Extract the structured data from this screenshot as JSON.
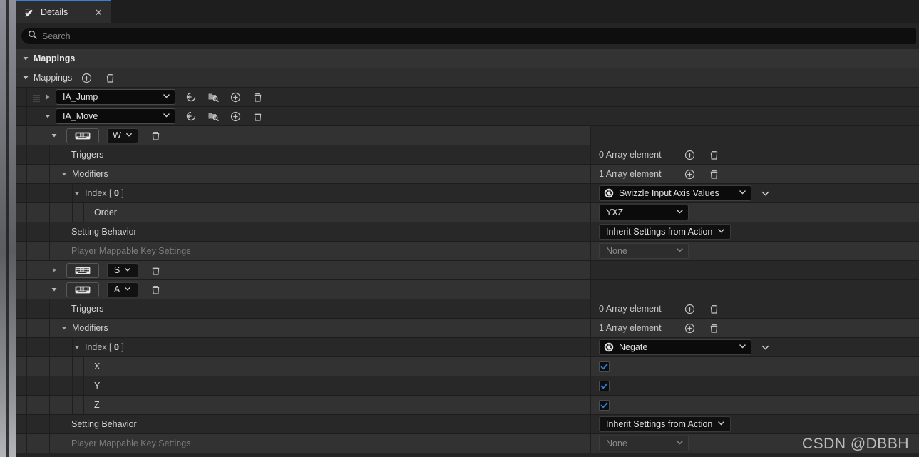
{
  "tab": {
    "title": "Details",
    "icon": "details-edit-icon",
    "close": "✕"
  },
  "search": {
    "placeholder": "Search",
    "icon": "search-icon"
  },
  "accent_color": "#3a7fd5",
  "checkbox_color": "#2a7fe0",
  "watermark": "CSDN @DBBH",
  "labels": {
    "category_mappings": "Mappings",
    "array_mappings": "Mappings",
    "triggers": "Triggers",
    "modifiers": "Modifiers",
    "index0": "Index [ 0 ]",
    "index_prefix": "Index [ ",
    "index_value": "0",
    "index_suffix": " ]",
    "order": "Order",
    "setting_behavior": "Setting Behavior",
    "player_mappable": "Player Mappable Key Settings",
    "axis_x": "X",
    "axis_y": "Y",
    "axis_z": "Z"
  },
  "values": {
    "action_jump": "IA_Jump",
    "action_move": "IA_Move",
    "key_w": "W",
    "key_s": "S",
    "key_a": "A",
    "triggers_count": "0 Array element",
    "modifiers_count": "1 Array element",
    "modifier_swizzle": "Swizzle Input Axis Values",
    "modifier_negate": "Negate",
    "order_value": "YXZ",
    "behavior_value": "Inherit Settings from Action",
    "none_value": "None"
  },
  "icons": {
    "reset": "reset-to-default-icon",
    "browse": "browse-asset-icon",
    "add": "add-element-icon",
    "delete": "delete-element-icon",
    "keyboard": "keyboard-key-icon",
    "chevron": "chevron-down-icon",
    "expanded": "triangle-down-icon",
    "collapsed": "triangle-right-icon",
    "class": "class-sphere-icon",
    "check": "checkmark-icon"
  }
}
